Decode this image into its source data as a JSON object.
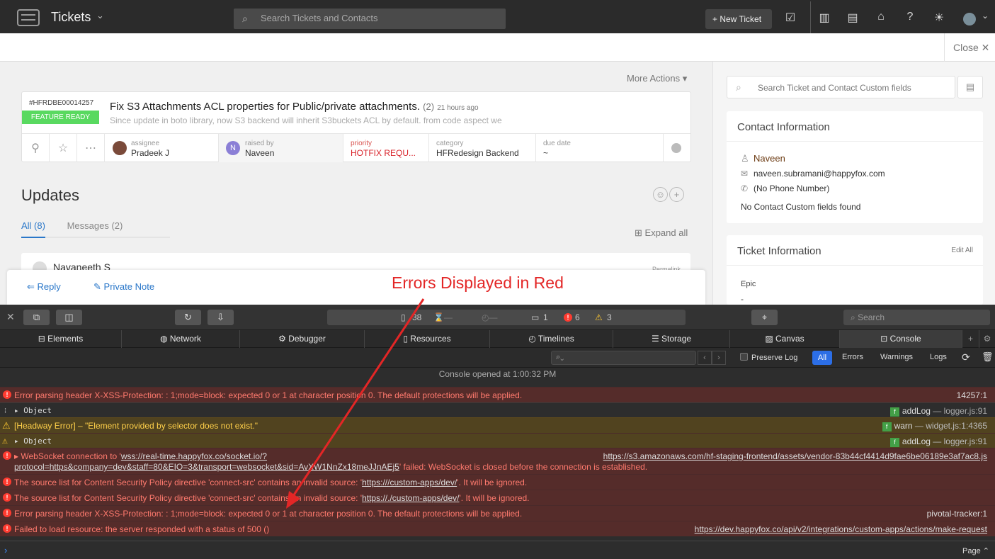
{
  "topbar": {
    "title": "Tickets",
    "search_placeholder": "Search Tickets and Contacts",
    "new_ticket_label": "+ New Ticket"
  },
  "subbar": {
    "close_label": "Close ✕"
  },
  "main": {
    "more_actions": "More Actions ▾",
    "ticket": {
      "id": "#HFRDBE00014257",
      "status_badge": "FEATURE READY",
      "title": "Fix S3 Attachments ACL properties for Public/private attachments.",
      "count": "(2)",
      "time_ago": "21 hours ago",
      "description": "Since update in boto library, now S3 backend will inherit S3buckets ACL by default. from code aspect we",
      "assignee_label": "assignee",
      "assignee": "Pradeek J",
      "raised_by_label": "raised by",
      "raised_by": "Naveen",
      "raised_initial": "N",
      "priority_label": "priority",
      "priority": "HOTFIX REQU...",
      "category_label": "category",
      "category": "HFRedesign Backend",
      "due_date_label": "due date",
      "due_date": "~"
    },
    "updates_title": "Updates",
    "tabs": {
      "all": "All (8)",
      "messages": "Messages (2)"
    },
    "expand_all": "Expand all",
    "first_update_name": "Navaneeth S",
    "permalink": "Permalink",
    "reply": "Reply",
    "private_note": "Private Note"
  },
  "annotation": {
    "text": "Errors Displayed in Red",
    "color": "#e32626"
  },
  "right_panel": {
    "search_placeholder": "Search Ticket and Contact Custom fields",
    "contact": {
      "heading": "Contact Information",
      "name": "Naveen",
      "email": "naveen.subramani@happyfox.com",
      "phone": "(No Phone Number)",
      "custom_fields": "No Contact Custom fields found"
    },
    "ticket_info": {
      "heading": "Ticket Information",
      "edit_all": "Edit All",
      "epic_label": "Epic",
      "epic_value": "-"
    }
  },
  "devtools": {
    "activity": {
      "resources": "38",
      "messages": "1",
      "errors": "6",
      "warnings": "3"
    },
    "search_placeholder": "Search",
    "tabs": [
      "Elements",
      "Network",
      "Debugger",
      "Resources",
      "Timelines",
      "Storage",
      "Canvas",
      "Console"
    ],
    "filter": {
      "preserve_log": "Preserve Log",
      "all": "All",
      "errors": "Errors",
      "warnings": "Warnings",
      "logs": "Logs"
    },
    "console_opened": "Console opened at 1:00:32 PM",
    "rows": {
      "r1_text": "Error parsing header X-XSS-Protection: : 1;mode=block: expected 0 or 1 at character position 0. The default protections will be applied.",
      "r1_src": "14257:1",
      "r2_text": "Object",
      "r2_fn": "addLog",
      "r2_src": " — logger.js:91",
      "r3_text": "[Headway Error] – \"Element provided by selector does not exist.\"",
      "r3_fn": "warn",
      "r3_src": " — widget.js:1:4365",
      "r4_text": "Object",
      "r4_fn": "addLog",
      "r4_src": " — logger.js:91",
      "r5_pre": "WebSocket connection to '",
      "r5_link1": "wss://real-time.happyfox.co/socket.io/?",
      "r5_src": "https://s3.amazonaws.com/hf-staging-frontend/assets/vendor-83b44cf4414d9fae6be06189e3af7ac8.js",
      "r5_link2": "protocol=https&company=dev&staff=80&EIO=3&transport=websocket&sid=AvXW1NnZx18meJJnAEj5",
      "r5_post": "' failed: WebSocket is closed before the connection is established.",
      "r6_pre": "The source list for Content Security Policy directive 'connect-src' contains an invalid source: '",
      "r6_link": "https:///custom-apps/dev/",
      "r6_post": "'. It will be ignored.",
      "r7_pre": "The source list for Content Security Policy directive 'connect-src' contains an invalid source: '",
      "r7_link": "https://./custom-apps/dev/",
      "r7_post": "'. It will be ignored.",
      "r8_text": "Error parsing header X-XSS-Protection: : 1;mode=block: expected 0 or 1 at character position 0. The default protections will be applied.",
      "r8_src": "pivotal-tracker:1",
      "r9_text": "Failed to load resource: the server responded with a status of 500 ()",
      "r9_src": "https://dev.happyfox.co/api/v2/integrations/custom-apps/actions/make-request"
    },
    "page_selector": "Page ⌃"
  }
}
